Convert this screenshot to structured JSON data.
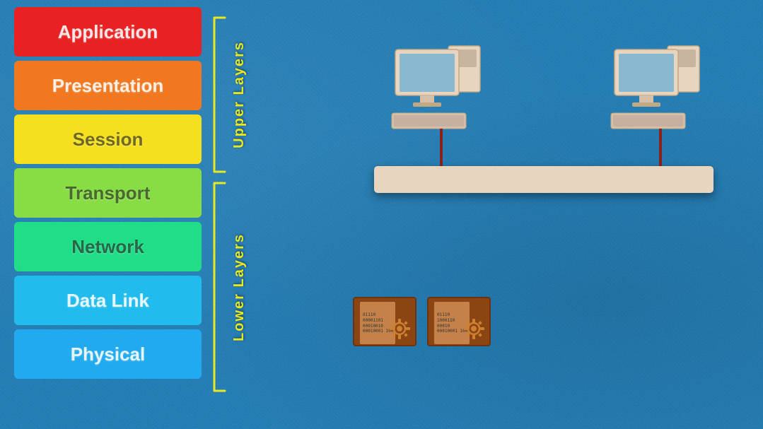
{
  "layers": [
    {
      "id": "application",
      "label": "Application",
      "class": "layer-application"
    },
    {
      "id": "presentation",
      "label": "Presentation",
      "class": "layer-presentation"
    },
    {
      "id": "session",
      "label": "Session",
      "class": "layer-session"
    },
    {
      "id": "transport",
      "label": "Transport",
      "class": "layer-transport"
    },
    {
      "id": "network",
      "label": "Network",
      "class": "layer-network"
    },
    {
      "id": "datalink",
      "label": "Data Link",
      "class": "layer-datalink"
    },
    {
      "id": "physical",
      "label": "Physical",
      "class": "layer-physical"
    }
  ],
  "bracket_upper_label": "Upper Layers",
  "bracket_lower_label": "Lower Layers",
  "diagram": {
    "network_bar_color": "#e8d5c0",
    "cable_color": "#8b2020"
  }
}
